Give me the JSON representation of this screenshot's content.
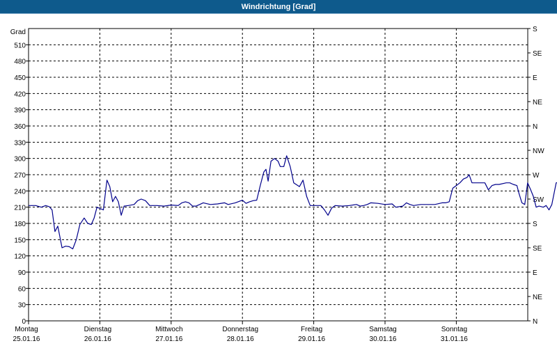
{
  "chart_data": {
    "type": "line",
    "title": "Windrichtung [Grad]",
    "ylabel": "Grad",
    "ylim": [
      0,
      540
    ],
    "xlim": [
      0,
      7
    ],
    "grid": true,
    "left_ticks": [
      "0",
      "30",
      "60",
      "90",
      "120",
      "150",
      "180",
      "210",
      "240",
      "270",
      "300",
      "330",
      "360",
      "390",
      "420",
      "450",
      "480",
      "510"
    ],
    "right_ticks": [
      "N",
      "NE",
      "E",
      "SE",
      "S",
      "SW",
      "W",
      "NW",
      "N",
      "NE",
      "E",
      "SE",
      "S"
    ],
    "day_labels": [
      {
        "day": "Montag",
        "date": "25.01.16"
      },
      {
        "day": "Dienstag",
        "date": "26.01.16"
      },
      {
        "day": "Mittwoch",
        "date": "27.01.16"
      },
      {
        "day": "Donnerstag",
        "date": "28.01.16"
      },
      {
        "day": "Freitag",
        "date": "29.01.16"
      },
      {
        "day": "Samstag",
        "date": "30.01.16"
      },
      {
        "day": "Sonntag",
        "date": "31.01.16"
      }
    ],
    "series": [
      {
        "color": "#00008b",
        "points": [
          [
            0.0,
            213
          ],
          [
            0.1,
            213
          ],
          [
            0.18,
            210
          ],
          [
            0.24,
            213
          ],
          [
            0.29,
            211
          ],
          [
            0.33,
            205
          ],
          [
            0.37,
            165
          ],
          [
            0.41,
            175
          ],
          [
            0.47,
            135
          ],
          [
            0.52,
            138
          ],
          [
            0.57,
            137
          ],
          [
            0.62,
            133
          ],
          [
            0.67,
            150
          ],
          [
            0.72,
            178
          ],
          [
            0.78,
            190
          ],
          [
            0.83,
            180
          ],
          [
            0.88,
            178
          ],
          [
            0.92,
            190
          ],
          [
            0.96,
            210
          ],
          [
            1.05,
            205
          ],
          [
            1.1,
            260
          ],
          [
            1.14,
            248
          ],
          [
            1.18,
            220
          ],
          [
            1.22,
            230
          ],
          [
            1.26,
            220
          ],
          [
            1.3,
            195
          ],
          [
            1.34,
            212
          ],
          [
            1.4,
            213
          ],
          [
            1.48,
            215
          ],
          [
            1.53,
            222
          ],
          [
            1.58,
            225
          ],
          [
            1.64,
            222
          ],
          [
            1.7,
            213
          ],
          [
            1.8,
            213
          ],
          [
            1.9,
            212
          ],
          [
            2.0,
            214
          ],
          [
            2.1,
            213
          ],
          [
            2.15,
            218
          ],
          [
            2.2,
            220
          ],
          [
            2.25,
            218
          ],
          [
            2.3,
            212
          ],
          [
            2.35,
            212
          ],
          [
            2.4,
            215
          ],
          [
            2.45,
            218
          ],
          [
            2.55,
            215
          ],
          [
            2.65,
            216
          ],
          [
            2.75,
            218
          ],
          [
            2.8,
            215
          ],
          [
            2.9,
            218
          ],
          [
            3.0,
            223
          ],
          [
            3.05,
            217
          ],
          [
            3.1,
            220
          ],
          [
            3.15,
            222
          ],
          [
            3.2,
            223
          ],
          [
            3.25,
            250
          ],
          [
            3.3,
            275
          ],
          [
            3.33,
            280
          ],
          [
            3.36,
            258
          ],
          [
            3.4,
            295
          ],
          [
            3.45,
            300
          ],
          [
            3.5,
            295
          ],
          [
            3.53,
            285
          ],
          [
            3.58,
            285
          ],
          [
            3.62,
            305
          ],
          [
            3.67,
            285
          ],
          [
            3.72,
            255
          ],
          [
            3.8,
            248
          ],
          [
            3.85,
            260
          ],
          [
            3.9,
            230
          ],
          [
            3.95,
            213
          ],
          [
            4.05,
            213
          ],
          [
            4.1,
            213
          ],
          [
            4.15,
            205
          ],
          [
            4.2,
            195
          ],
          [
            4.25,
            208
          ],
          [
            4.3,
            213
          ],
          [
            4.4,
            212
          ],
          [
            4.5,
            213
          ],
          [
            4.6,
            215
          ],
          [
            4.65,
            212
          ],
          [
            4.7,
            213
          ],
          [
            4.75,
            215
          ],
          [
            4.8,
            218
          ],
          [
            4.9,
            217
          ],
          [
            5.0,
            215
          ],
          [
            5.1,
            216
          ],
          [
            5.15,
            210
          ],
          [
            5.25,
            212
          ],
          [
            5.3,
            218
          ],
          [
            5.35,
            215
          ],
          [
            5.4,
            213
          ],
          [
            5.5,
            215
          ],
          [
            5.6,
            215
          ],
          [
            5.7,
            215
          ],
          [
            5.8,
            218
          ],
          [
            5.85,
            218
          ],
          [
            5.9,
            220
          ],
          [
            5.95,
            245
          ],
          [
            6.0,
            250
          ],
          [
            6.05,
            255
          ],
          [
            6.1,
            262
          ],
          [
            6.15,
            265
          ],
          [
            6.18,
            270
          ],
          [
            6.22,
            255
          ],
          [
            6.3,
            255
          ],
          [
            6.4,
            255
          ],
          [
            6.45,
            242
          ],
          [
            6.5,
            250
          ],
          [
            6.55,
            252
          ],
          [
            6.6,
            252
          ],
          [
            6.7,
            255
          ],
          [
            6.75,
            255
          ],
          [
            6.8,
            252
          ],
          [
            6.85,
            250
          ],
          [
            6.88,
            235
          ],
          [
            6.92,
            218
          ],
          [
            6.96,
            215
          ],
          [
            7.0,
            255
          ],
          [
            7.04,
            243
          ],
          [
            7.08,
            230
          ],
          [
            7.12,
            210
          ],
          [
            7.16,
            212
          ],
          [
            7.22,
            210
          ],
          [
            7.26,
            213
          ],
          [
            7.3,
            205
          ],
          [
            7.34,
            215
          ],
          [
            7.4,
            255
          ],
          [
            7.47,
            257
          ],
          [
            7.52,
            257
          ]
        ]
      }
    ]
  }
}
